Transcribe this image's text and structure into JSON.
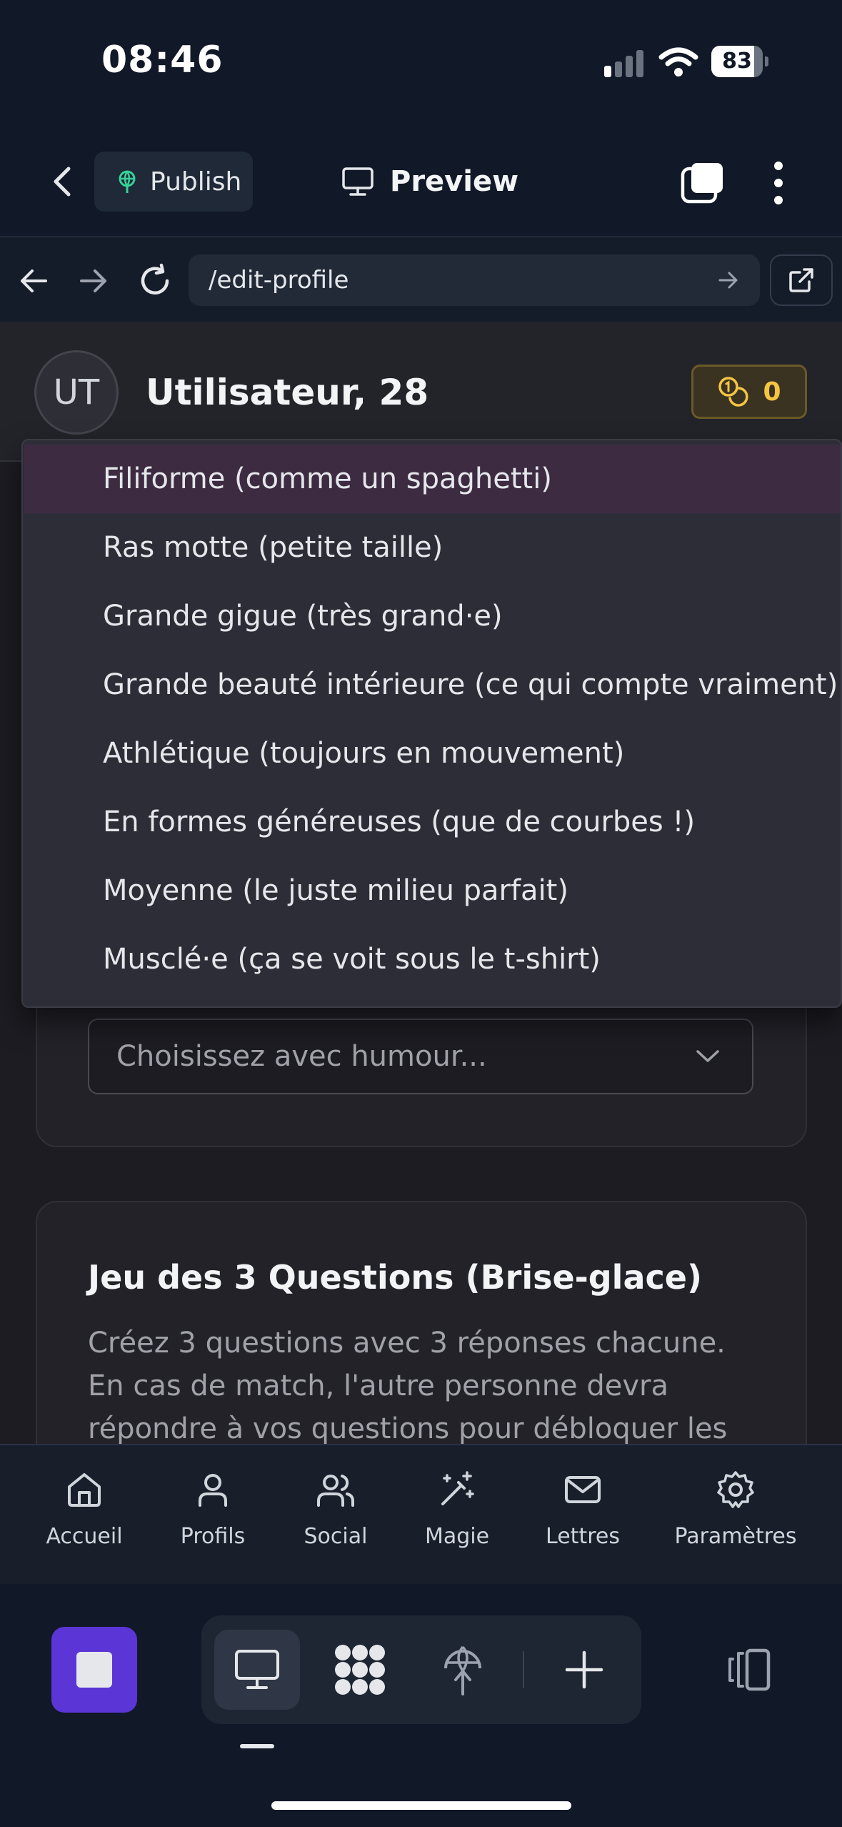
{
  "status_bar": {
    "time": "08:46",
    "battery": "83"
  },
  "header": {
    "publish_label": "Publish",
    "preview_label": "Preview"
  },
  "browser": {
    "url": "/edit-profile"
  },
  "profile": {
    "initials": "UT",
    "name": "Utilisateur, 28",
    "coins": "0"
  },
  "dropdown": {
    "options": [
      "Filiforme (comme un spaghetti)",
      "Ras motte (petite taille)",
      "Grande gigue (très grand·e)",
      "Grande beauté intérieure (ce qui compte vraiment)",
      "Athlétique (toujours en mouvement)",
      "En formes généreuses (que de courbes !)",
      "Moyenne (le juste milieu parfait)",
      "Musclé·e (ça se voit sous le t-shirt)"
    ]
  },
  "body_select": {
    "placeholder": "Choisissez avec humour..."
  },
  "questions_card": {
    "title": "Jeu des 3 Questions (Brise-glace)",
    "desc_lines": [
      "Créez 3 questions avec 3 réponses chacune.",
      "En cas de match, l'autre personne devra",
      "répondre à vos questions pour débloquer les"
    ]
  },
  "bottom_nav": [
    {
      "label": "Accueil",
      "icon": "home-icon"
    },
    {
      "label": "Profils",
      "icon": "user-icon"
    },
    {
      "label": "Social",
      "icon": "users-icon"
    },
    {
      "label": "Magie",
      "icon": "magic-wand-icon"
    },
    {
      "label": "Lettres",
      "icon": "mail-icon"
    },
    {
      "label": "Paramètres",
      "icon": "gear-icon"
    }
  ],
  "colors": {
    "accent": "#5b35d5",
    "coin": "#f5c542",
    "active_option": "#3d2b42",
    "background": "#111827"
  }
}
